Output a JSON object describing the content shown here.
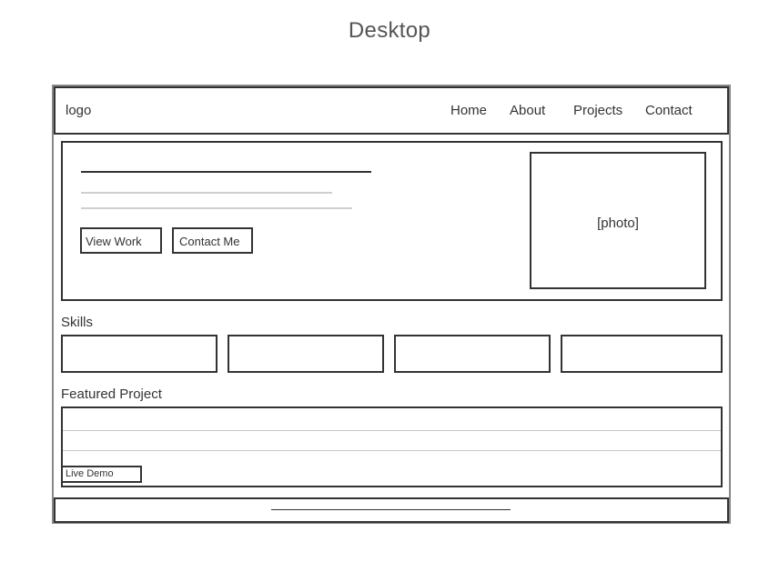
{
  "page_title": "Desktop",
  "header": {
    "logo": "logo",
    "nav": [
      "Home",
      "About",
      "Projects",
      "Contact"
    ]
  },
  "hero": {
    "buttons": {
      "view_work": "View Work",
      "contact_me": "Contact Me"
    },
    "photo_label": "[photo]"
  },
  "skills": {
    "heading": "Skills"
  },
  "featured": {
    "heading": "Featured Project",
    "live_demo": "Live Demo"
  }
}
